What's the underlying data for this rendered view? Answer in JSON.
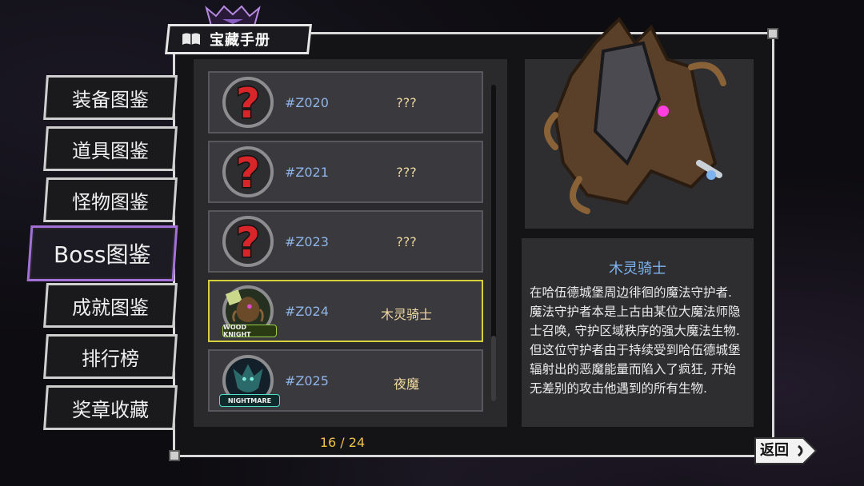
{
  "header": {
    "title": "宝藏手册"
  },
  "sidebar": {
    "items": [
      {
        "label": "装备图鉴"
      },
      {
        "label": "道具图鉴"
      },
      {
        "label": "怪物图鉴"
      },
      {
        "label": "Boss图鉴"
      },
      {
        "label": "成就图鉴"
      },
      {
        "label": "排行榜"
      },
      {
        "label": "奖章收藏"
      }
    ],
    "active": "Boss图鉴"
  },
  "list": {
    "rows": [
      {
        "id": "#Z020",
        "name": "???",
        "badge": "question-mark-icon"
      },
      {
        "id": "#Z021",
        "name": "???",
        "badge": "question-mark-icon"
      },
      {
        "id": "#Z023",
        "name": "???",
        "badge": "question-mark-icon"
      },
      {
        "id": "#Z024",
        "name": "木灵骑士",
        "badge": "wood-knight-portrait",
        "badge_text": "WOOD KNIGHT",
        "selected": true
      },
      {
        "id": "#Z025",
        "name": "夜魔",
        "badge": "nightmare-portrait",
        "badge_text": "NIGHTMARE"
      }
    ]
  },
  "pager": {
    "text": "16 / 24"
  },
  "detail": {
    "name": "木灵骑士",
    "description": "在哈伍德城堡周边徘徊的魔法守护者. 魔法守护者本是上古由某位大魔法师隐士召唤, 守护区域秩序的强大魔法生物. 但这位守护者由于持续受到哈伍德城堡辐射出的恶魔能量而陷入了疯狂, 开始无差别的攻击他遇到的所有生物."
  },
  "back_button": {
    "label": "返回"
  },
  "colors": {
    "accent_purple": "#a470d8",
    "selected_border": "#d6d13a",
    "id_blue": "#8fb4e8",
    "name_gold": "#f0d8a0",
    "pager_gold": "#f1c24a",
    "title_blue": "#7fb3f0",
    "question_red": "#d8252a"
  }
}
